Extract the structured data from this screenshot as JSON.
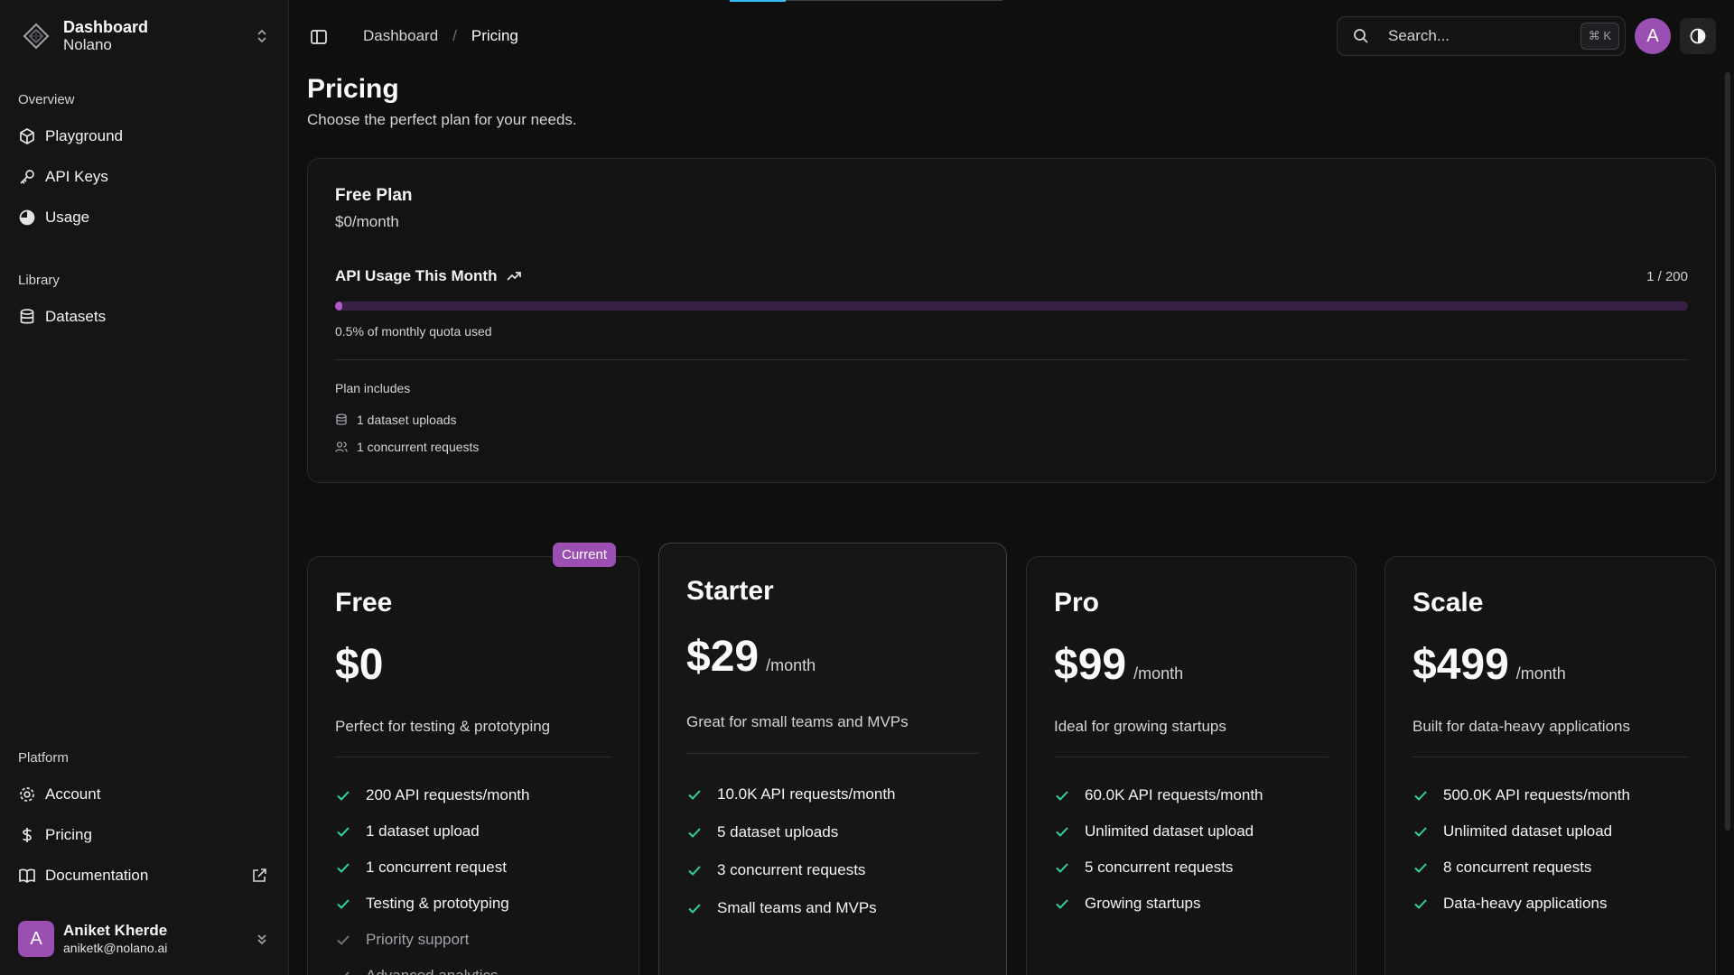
{
  "workspace": {
    "title": "Dashboard",
    "subtitle": "Nolano"
  },
  "sidebar": {
    "overview_label": "Overview",
    "overview_items": [
      {
        "label": "Playground",
        "icon": "cube-icon"
      },
      {
        "label": "API Keys",
        "icon": "key-icon"
      },
      {
        "label": "Usage",
        "icon": "pie-chart-icon"
      }
    ],
    "library_label": "Library",
    "library_items": [
      {
        "label": "Datasets",
        "icon": "database-icon"
      }
    ],
    "platform_label": "Platform",
    "platform_items": [
      {
        "label": "Account",
        "icon": "gear-icon"
      },
      {
        "label": "Pricing",
        "icon": "dollar-icon"
      },
      {
        "label": "Documentation",
        "icon": "book-icon"
      }
    ]
  },
  "user": {
    "initial": "A",
    "name": "Aniket Kherde",
    "email": "aniketk@nolano.ai"
  },
  "header": {
    "breadcrumb": [
      "Dashboard",
      "Pricing"
    ],
    "breadcrumb_sep": "/",
    "search_placeholder": "Search...",
    "search_shortcut": "⌘ K",
    "avatar_initial": "A"
  },
  "page": {
    "title": "Pricing",
    "subtitle": "Choose the perfect plan for your needs."
  },
  "current_plan": {
    "name": "Free Plan",
    "price": "$0/month",
    "usage_title": "API Usage This Month",
    "usage_count": "1 / 200",
    "usage_fraction": 0.005,
    "usage_text": "0.5% of monthly quota used",
    "includes_label": "Plan includes",
    "includes": [
      "1 dataset uploads",
      "1 concurrent requests"
    ]
  },
  "tiers": [
    {
      "name": "Free",
      "price": "$0",
      "period": "",
      "badge": "Current",
      "description": "Perfect for testing & prototyping",
      "features": [
        "200 API requests/month",
        "1 dataset upload",
        "1 concurrent request",
        "Testing & prototyping"
      ],
      "muted_features": [
        "Priority support",
        "Advanced analytics"
      ]
    },
    {
      "name": "Starter",
      "price": "$29",
      "period": "/month",
      "description": "Great for small teams and MVPs",
      "features": [
        "10.0K API requests/month",
        "5 dataset uploads",
        "3 concurrent requests",
        "Small teams and MVPs"
      ]
    },
    {
      "name": "Pro",
      "price": "$99",
      "period": "/month",
      "description": "Ideal for growing startups",
      "features": [
        "60.0K API requests/month",
        "Unlimited dataset upload",
        "5 concurrent requests",
        "Growing startups"
      ]
    },
    {
      "name": "Scale",
      "price": "$499",
      "period": "/month",
      "description": "Built for data-heavy applications",
      "features": [
        "500.0K API requests/month",
        "Unlimited dataset upload",
        "8 concurrent requests",
        "Data-heavy applications"
      ]
    }
  ],
  "colors": {
    "accent": "#9b4fb3",
    "progress_fill": "#b05ac7",
    "check": "#34d399",
    "background": "#0f0f10"
  }
}
